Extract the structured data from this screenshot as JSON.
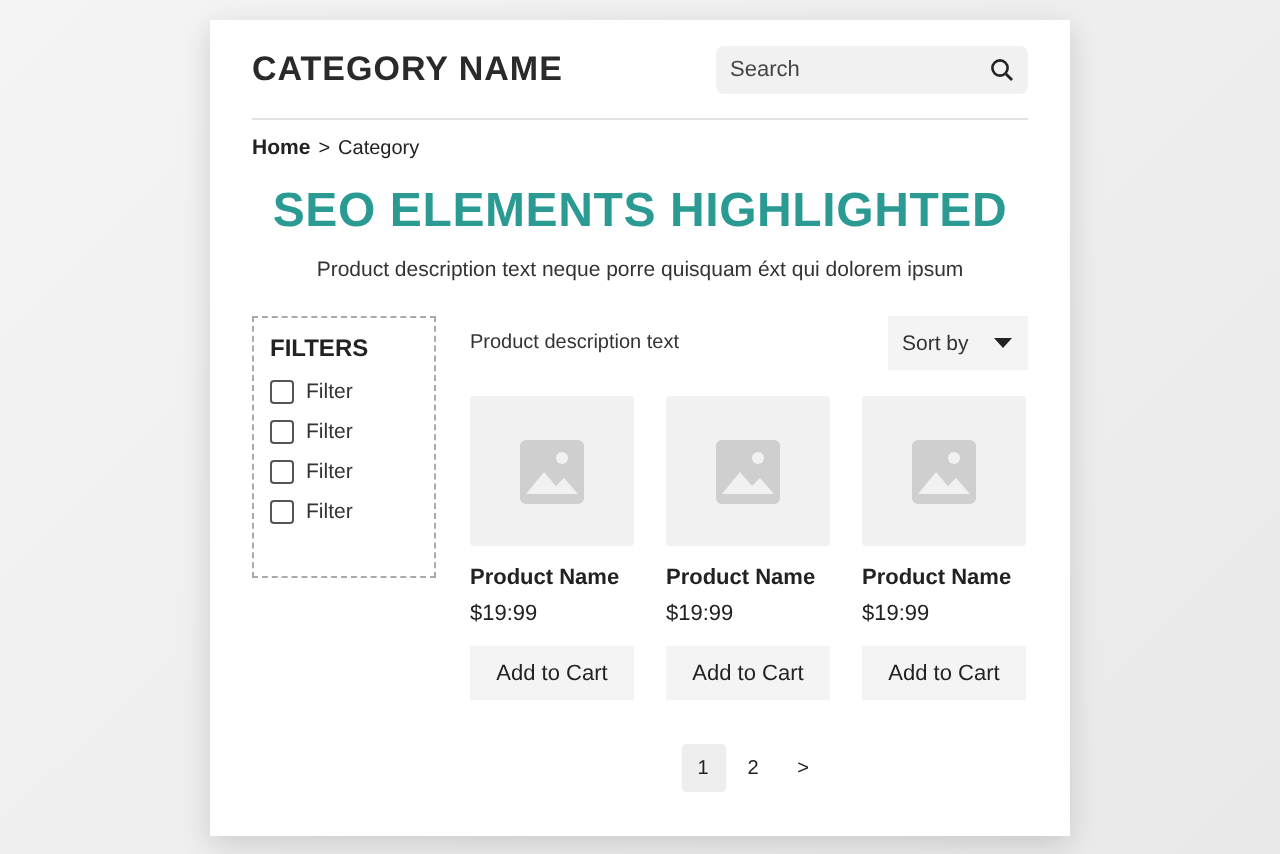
{
  "header": {
    "title": "CATEGORY NAME",
    "search": {
      "placeholder": "Search"
    }
  },
  "breadcrumb": [
    {
      "label": "Home",
      "current": false
    },
    {
      "label": ">",
      "current": true
    },
    {
      "label": "Category",
      "current": true
    }
  ],
  "heading": "SEO ELEMENTS HIGHLIGHTED",
  "description": "Product description text neque porre quisquam éxt qui dolorem ipsum",
  "filters": {
    "title": "FILTERS",
    "items": [
      {
        "label": "Filter",
        "checked": false
      },
      {
        "label": "Filter",
        "checked": false
      },
      {
        "label": "Filter",
        "checked": false
      },
      {
        "label": "Filter",
        "checked": false
      }
    ]
  },
  "listing": {
    "text": "Product description text",
    "sort": "Sort by"
  },
  "products": [
    {
      "name": "Product Name",
      "price": "$19:99",
      "button": "Add to Cart"
    },
    {
      "name": "Product Name",
      "price": "$19:99",
      "button": "Add to Cart"
    },
    {
      "name": "Product Name",
      "price": "$19:99",
      "button": "Add to Cart"
    }
  ],
  "pagination": [
    {
      "label": "1",
      "selected": true
    },
    {
      "label": "2",
      "selected": false
    },
    {
      "label": ">",
      "selected": false
    }
  ]
}
